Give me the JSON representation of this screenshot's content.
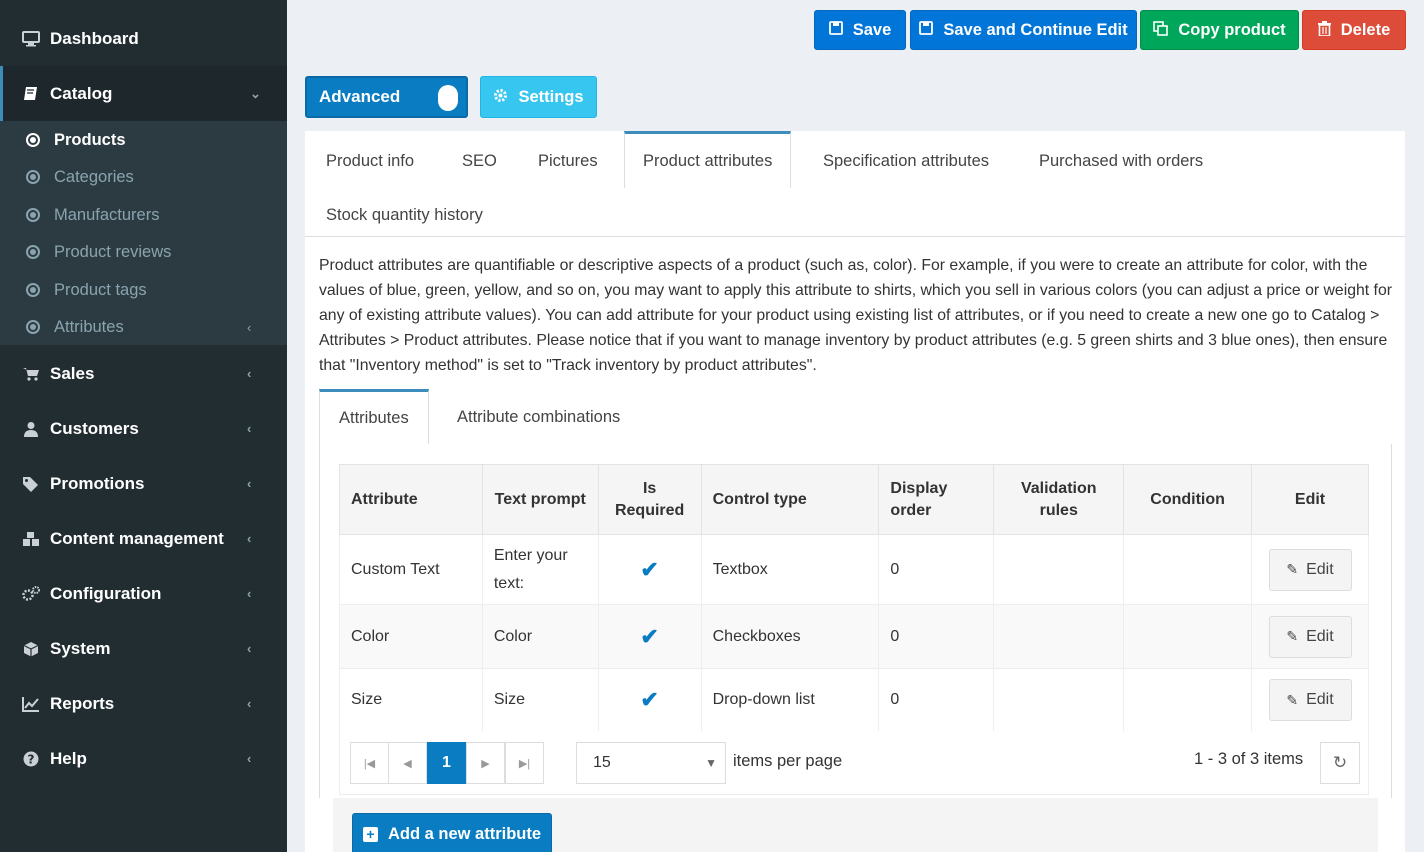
{
  "sidebar": {
    "items": [
      {
        "label": "Dashboard",
        "icon": "desktop-icon"
      },
      {
        "label": "Catalog",
        "icon": "book-icon"
      },
      {
        "label": "Sales",
        "icon": "cart-icon"
      },
      {
        "label": "Customers",
        "icon": "user-icon"
      },
      {
        "label": "Promotions",
        "icon": "tags-icon"
      },
      {
        "label": "Content management",
        "icon": "cubes-icon"
      },
      {
        "label": "Configuration",
        "icon": "gears-icon"
      },
      {
        "label": "System",
        "icon": "cube-icon"
      },
      {
        "label": "Reports",
        "icon": "line-chart-icon"
      },
      {
        "label": "Help",
        "icon": "question-circle-icon"
      }
    ],
    "catalog_sub": [
      {
        "label": "Products"
      },
      {
        "label": "Categories"
      },
      {
        "label": "Manufacturers"
      },
      {
        "label": "Product reviews"
      },
      {
        "label": "Product tags"
      },
      {
        "label": "Attributes"
      }
    ]
  },
  "toolbar": {
    "save": "Save",
    "save_continue": "Save and Continue Edit",
    "copy": "Copy product",
    "delete": "Delete",
    "advanced": "Advanced",
    "settings": "Settings"
  },
  "tabs": [
    "Product info",
    "SEO",
    "Pictures",
    "Product attributes",
    "Specification attributes",
    "Purchased with orders",
    "Stock quantity history"
  ],
  "description": "Product attributes are quantifiable or descriptive aspects of a product (such as, color). For example, if you were to create an attribute for color, with the values of blue, green, yellow, and so on, you may want to apply this attribute to shirts, which you sell in various colors (you can adjust a price or weight for any of existing attribute values). You can add attribute for your product using existing list of attributes, or if you need to create a new one go to Catalog > Attributes > Product attributes. Please notice that if you want to manage inventory by product attributes (e.g. 5 green shirts and 3 blue ones), then ensure that \"Inventory method\" is set to \"Track inventory by product attributes\".",
  "subtabs": [
    "Attributes",
    "Attribute combinations"
  ],
  "table": {
    "headers": {
      "attribute": "Attribute",
      "text_prompt": "Text prompt",
      "is_required_1": "Is",
      "is_required_2": "Required",
      "control_type": "Control type",
      "display_order_1": "Display",
      "display_order_2": "order",
      "validation_1": "Validation",
      "validation_2": "rules",
      "condition": "Condition",
      "edit": "Edit"
    },
    "rows": [
      {
        "attribute": "Custom Text",
        "prompt_1": "Enter your",
        "prompt_2": "text:",
        "control": "Textbox",
        "order": "0",
        "edit": "Edit"
      },
      {
        "attribute": "Color",
        "prompt_1": "Color",
        "control": "Checkboxes",
        "order": "0",
        "edit": "Edit"
      },
      {
        "attribute": "Size",
        "prompt_1": "Size",
        "control": "Drop-down list",
        "order": "0",
        "edit": "Edit"
      }
    ]
  },
  "pager": {
    "page": "1",
    "per_page": "15",
    "per_page_label": "items per page",
    "summary": "1 - 3 of 3 items"
  },
  "add_button": "Add a new attribute",
  "colors": {
    "sidebar_bg": "#222d32",
    "primary": "#0275d8",
    "success": "#00a65a",
    "danger": "#dd4b39",
    "info": "#36c6f0",
    "accent": "#3c8dbc"
  }
}
